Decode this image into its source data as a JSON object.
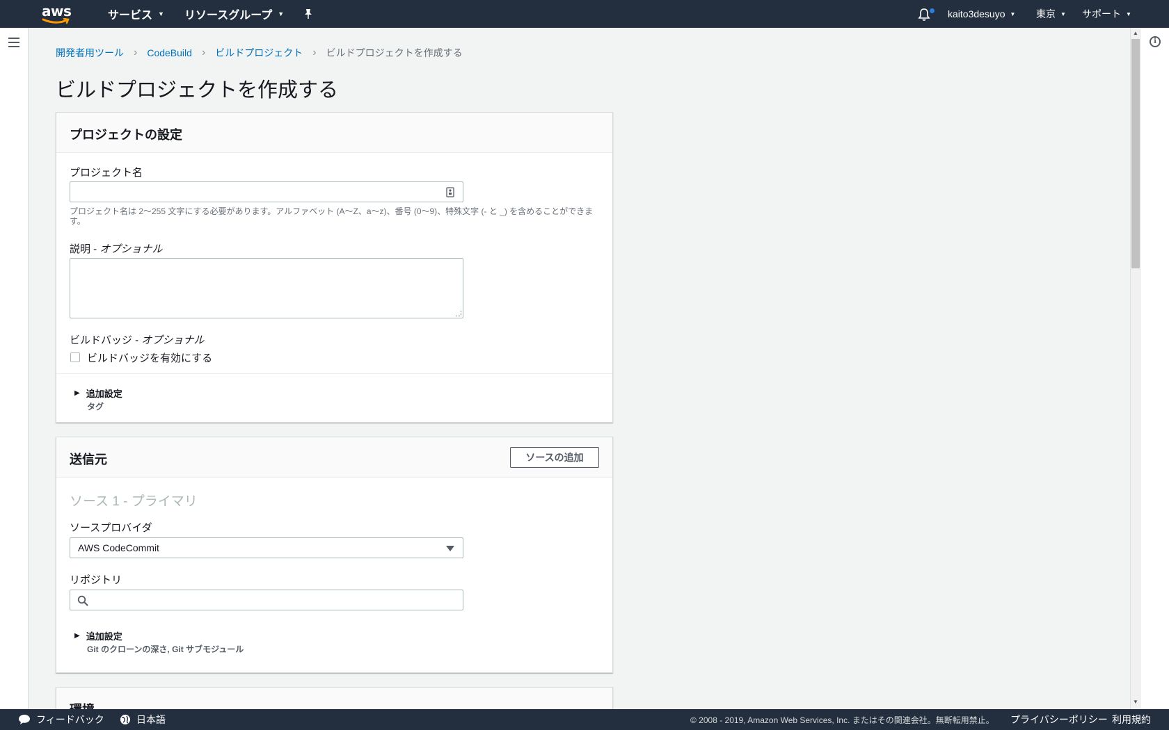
{
  "topnav": {
    "logo_text": "aws",
    "services": "サービス",
    "resource_groups": "リソースグループ",
    "user": "kaito3desuyo",
    "region": "東京",
    "support": "サポート"
  },
  "breadcrumb": {
    "items": [
      "開発者用ツール",
      "CodeBuild",
      "ビルドプロジェクト"
    ],
    "current": "ビルドプロジェクトを作成する"
  },
  "page_title": "ビルドプロジェクトを作成する",
  "project_settings": {
    "title": "プロジェクトの設定",
    "name_label": "プロジェクト名",
    "name_value": "",
    "name_hint": "プロジェクト名は 2〜255 文字にする必要があります。アルファベット (A〜Z、a〜z)、番号 (0〜9)、特殊文字 (- と _) を含めることができます。",
    "desc_label": "説明 - ",
    "desc_optional": "オプショナル",
    "badge_label": "ビルドバッジ - ",
    "badge_optional": "オプショナル",
    "badge_checkbox": "ビルドバッジを有効にする",
    "additional": "追加設定",
    "additional_sub": "タグ"
  },
  "source": {
    "title": "送信元",
    "add_button": "ソースの追加",
    "primary_title": "ソース 1 - プライマリ",
    "provider_label": "ソースプロバイダ",
    "provider_value": "AWS CodeCommit",
    "repo_label": "リポジトリ",
    "repo_value": "",
    "additional": "追加設定",
    "additional_sub": "Git のクローンの深さ, Git サブモジュール"
  },
  "environment": {
    "title": "環境"
  },
  "footer": {
    "feedback": "フィードバック",
    "language": "日本語",
    "copyright": "© 2008 - 2019, Amazon Web Services, Inc. またはその関連会社。無断転用禁止。",
    "privacy": "プライバシーポリシー",
    "terms": "利用規約"
  }
}
